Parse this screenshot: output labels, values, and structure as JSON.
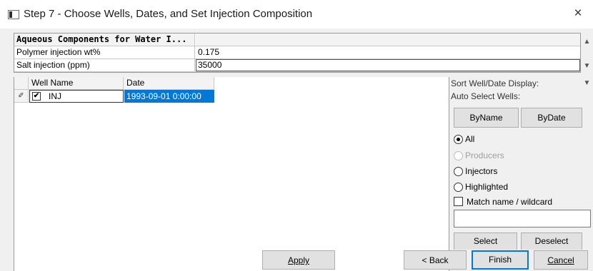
{
  "window": {
    "title": "Step 7 - Choose Wells, Dates, and Set Injection Composition",
    "close_glyph": "×"
  },
  "components": {
    "header_label": "Aqueous Components for Water I...",
    "rows": [
      {
        "label": "Polymer injection wt%",
        "value": "0.175"
      },
      {
        "label": "Salt injection (ppm)",
        "value": "35000"
      }
    ]
  },
  "wells": {
    "columns": [
      "Well Name",
      "Date"
    ],
    "rows": [
      {
        "checked": true,
        "check_glyph": "✔",
        "row_glyph": "✐",
        "name": "INJ",
        "date": "1993-09-01 0:00:00"
      }
    ]
  },
  "side": {
    "sort_label": "Sort Well/Date Display:",
    "auto_label": "Auto Select Wells:",
    "by_name": "ByName",
    "by_date": "ByDate",
    "radios": [
      {
        "label": "All",
        "selected": true,
        "enabled": true
      },
      {
        "label": "Producers",
        "selected": false,
        "enabled": false
      },
      {
        "label": "Injectors",
        "selected": false,
        "enabled": true
      },
      {
        "label": "Highlighted",
        "selected": false,
        "enabled": true
      }
    ],
    "match_label": "Match name / wildcard",
    "wildcard_value": "",
    "select": "Select",
    "deselect": "Deselect"
  },
  "footer": {
    "apply": "Apply",
    "back": "< Back",
    "finish": "Finish",
    "cancel": "Cancel"
  },
  "scroll": {
    "up": "▲",
    "down": "▼"
  }
}
